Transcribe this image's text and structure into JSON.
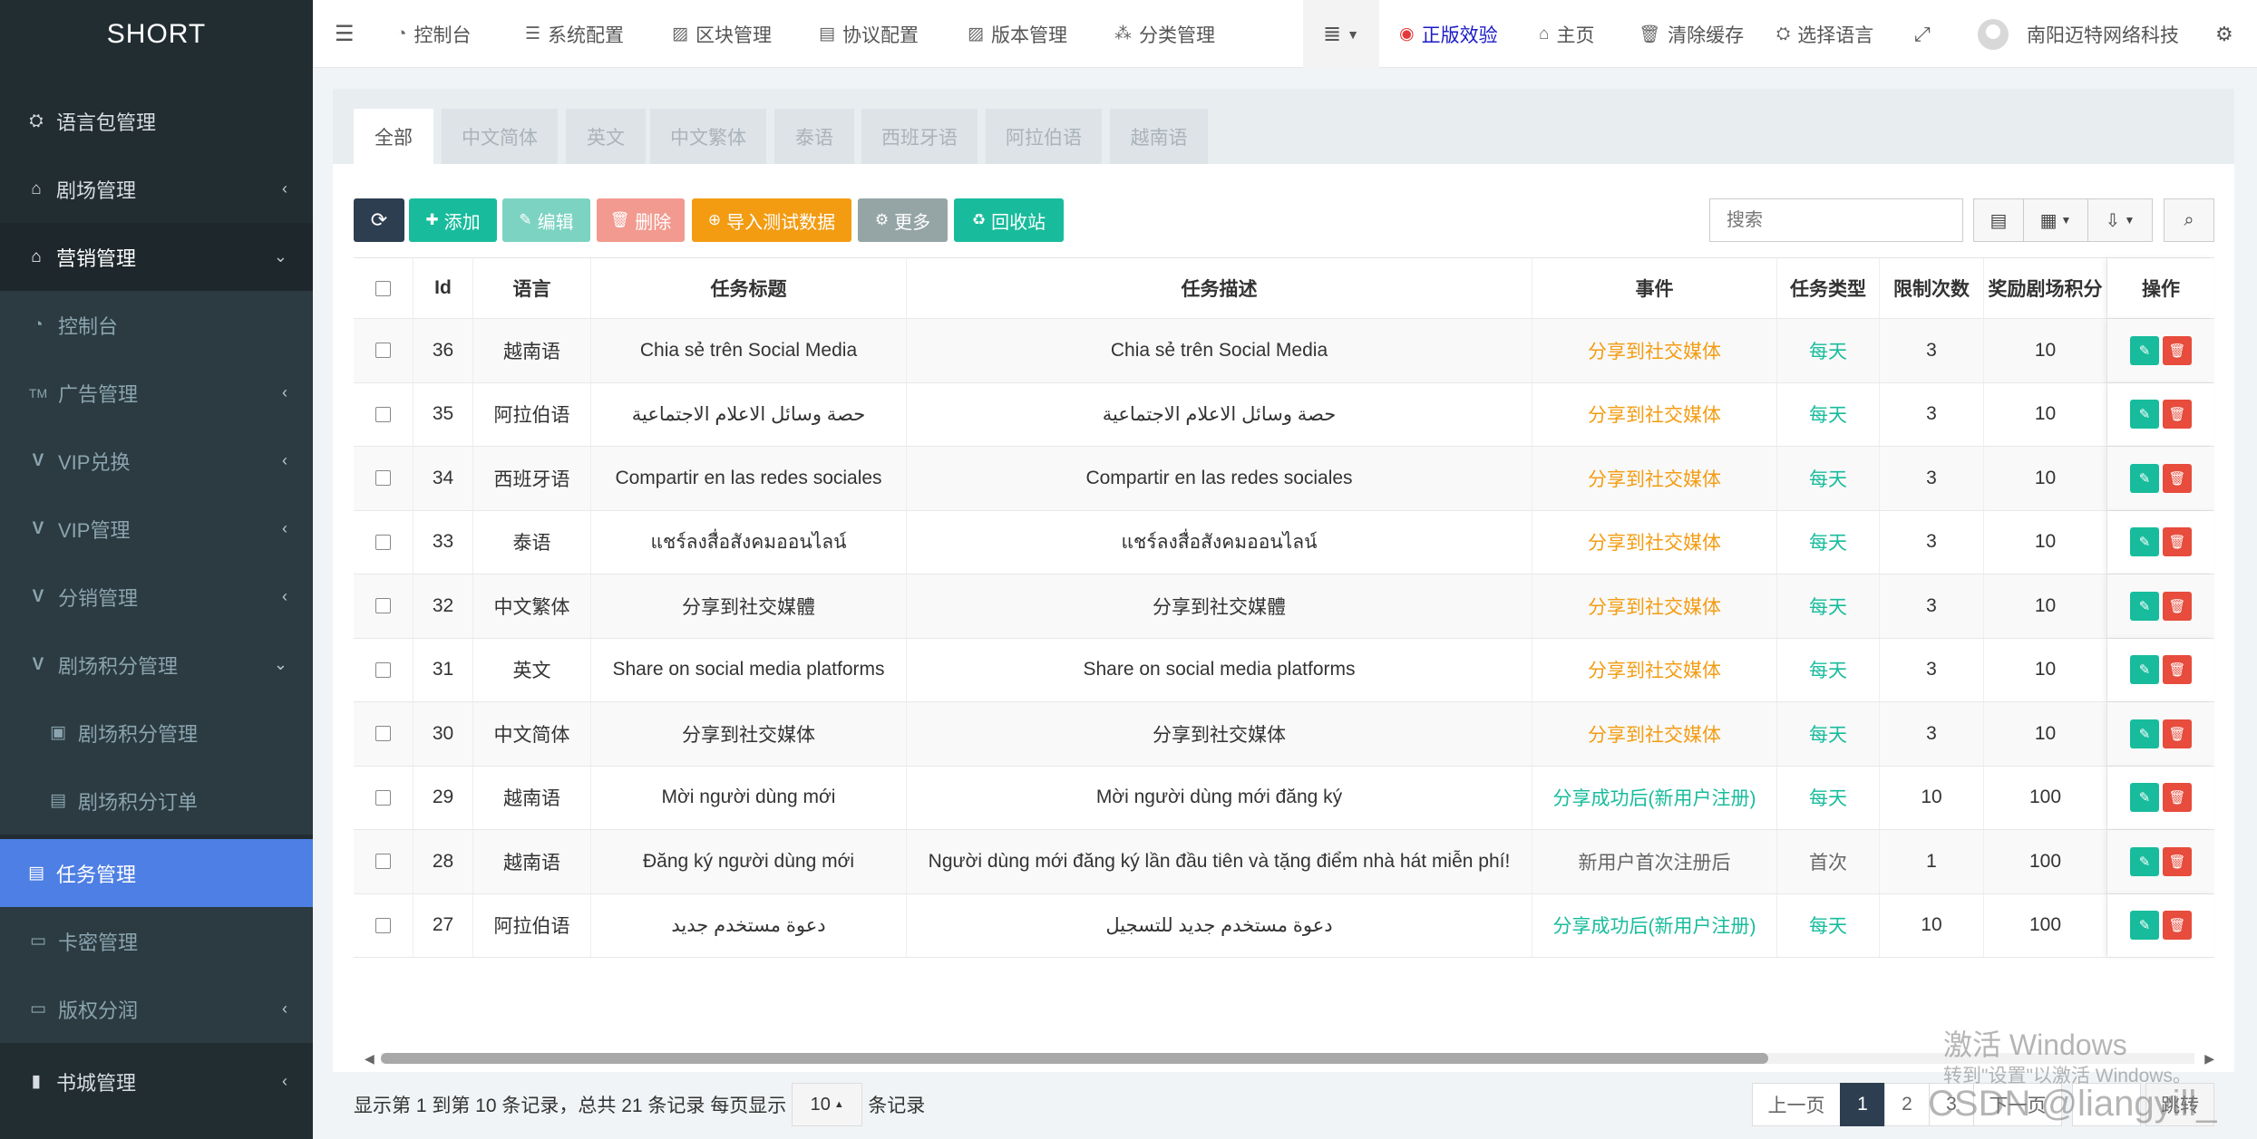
{
  "app": {
    "brand": "SHORT"
  },
  "sidebar": {
    "items": [
      {
        "label": "语言包管理",
        "icon": "language-icon"
      },
      {
        "label": "剧场管理",
        "icon": "home-icon"
      },
      {
        "label": "营销管理",
        "icon": "home-icon"
      },
      {
        "label": "控制台",
        "icon": "dashboard-icon"
      },
      {
        "label": "广告管理",
        "icon": "trademark-icon"
      },
      {
        "label": "VIP兑换",
        "icon": "vip-icon"
      },
      {
        "label": "VIP管理",
        "icon": "vip-icon"
      },
      {
        "label": "分销管理",
        "icon": "vip-icon"
      },
      {
        "label": "剧场积分管理",
        "icon": "vip-icon"
      },
      {
        "label": "剧场积分管理",
        "icon": "vip-badge-icon"
      },
      {
        "label": "剧场积分订单",
        "icon": "file-icon"
      },
      {
        "label": "任务管理",
        "icon": "file-icon"
      },
      {
        "label": "卡密管理",
        "icon": "card-icon"
      },
      {
        "label": "版权分润",
        "icon": "card-icon"
      },
      {
        "label": "书城管理",
        "icon": "book-icon"
      }
    ]
  },
  "topnav": {
    "items": [
      {
        "label": "控制台",
        "icon": "dashboard-icon"
      },
      {
        "label": "系统配置",
        "icon": "sliders-icon"
      },
      {
        "label": "区块管理",
        "icon": "image-icon"
      },
      {
        "label": "协议配置",
        "icon": "file-icon"
      },
      {
        "label": "版本管理",
        "icon": "image-icon"
      },
      {
        "label": "分类管理",
        "icon": "sitemap-icon"
      }
    ],
    "right": {
      "official": "正版效验",
      "home": "主页",
      "clear_cache": "清除缓存",
      "language": "选择语言",
      "user": "南阳迈特网络科技"
    }
  },
  "tabs": [
    "全部",
    "中文简体",
    "英文",
    "中文繁体",
    "泰语",
    "西班牙语",
    "阿拉伯语",
    "越南语"
  ],
  "toolbar": {
    "add": "添加",
    "edit": "编辑",
    "delete": "删除",
    "import": "导入测试数据",
    "more": "更多",
    "recycle": "回收站",
    "search_placeholder": "搜索"
  },
  "table": {
    "headers": {
      "id": "Id",
      "lang": "语言",
      "title": "任务标题",
      "desc": "任务描述",
      "event": "事件",
      "type": "任务类型",
      "limit": "限制次数",
      "reward": "奖励剧场积分",
      "ops": "操作"
    },
    "rows": [
      {
        "id": "36",
        "lang": "越南语",
        "title": "Chia sẻ trên Social Media",
        "desc": "Chia sẻ trên Social Media",
        "event": "分享到社交媒体",
        "event_color": "orange",
        "type": "每天",
        "type_color": "teal",
        "limit": "3",
        "reward": "10"
      },
      {
        "id": "35",
        "lang": "阿拉伯语",
        "title": "حصة وسائل الاعلام الاجتماعية",
        "desc": "حصة وسائل الاعلام الاجتماعية",
        "event": "分享到社交媒体",
        "event_color": "orange",
        "type": "每天",
        "type_color": "teal",
        "limit": "3",
        "reward": "10"
      },
      {
        "id": "34",
        "lang": "西班牙语",
        "title": "Compartir en las redes sociales",
        "desc": "Compartir en las redes sociales",
        "event": "分享到社交媒体",
        "event_color": "orange",
        "type": "每天",
        "type_color": "teal",
        "limit": "3",
        "reward": "10"
      },
      {
        "id": "33",
        "lang": "泰语",
        "title": "แชร์ลงสื่อสังคมออนไลน์",
        "desc": "แชร์ลงสื่อสังคมออนไลน์",
        "event": "分享到社交媒体",
        "event_color": "orange",
        "type": "每天",
        "type_color": "teal",
        "limit": "3",
        "reward": "10"
      },
      {
        "id": "32",
        "lang": "中文繁体",
        "title": "分享到社交媒體",
        "desc": "分享到社交媒體",
        "event": "分享到社交媒体",
        "event_color": "orange",
        "type": "每天",
        "type_color": "teal",
        "limit": "3",
        "reward": "10"
      },
      {
        "id": "31",
        "lang": "英文",
        "title": "Share on social media platforms",
        "desc": "Share on social media platforms",
        "event": "分享到社交媒体",
        "event_color": "orange",
        "type": "每天",
        "type_color": "teal",
        "limit": "3",
        "reward": "10"
      },
      {
        "id": "30",
        "lang": "中文简体",
        "title": "分享到社交媒体",
        "desc": "分享到社交媒体",
        "event": "分享到社交媒体",
        "event_color": "orange",
        "type": "每天",
        "type_color": "teal",
        "limit": "3",
        "reward": "10"
      },
      {
        "id": "29",
        "lang": "越南语",
        "title": "Mời người dùng mới",
        "desc": "Mời người dùng mới đăng ký",
        "event": "分享成功后(新用户注册)",
        "event_color": "teal",
        "type": "每天",
        "type_color": "teal",
        "limit": "10",
        "reward": "100"
      },
      {
        "id": "28",
        "lang": "越南语",
        "title": "Đăng ký người dùng mới",
        "desc": "Người dùng mới đăng ký lần đầu tiên và tặng điểm nhà hát miễn phí!",
        "event": "新用户首次注册后",
        "event_color": "gray",
        "type": "首次",
        "type_color": "gray",
        "limit": "1",
        "reward": "100"
      },
      {
        "id": "27",
        "lang": "阿拉伯语",
        "title": "دعوة مستخدم جديد",
        "desc": "دعوة مستخدم جديد للتسجيل",
        "event": "分享成功后(新用户注册)",
        "event_color": "teal",
        "type": "每天",
        "type_color": "teal",
        "limit": "10",
        "reward": "100"
      }
    ]
  },
  "footer": {
    "info": "显示第 1 到第 10 条记录，总共 21 条记录 每页显示",
    "page_size": "10",
    "suffix": "条记录",
    "prev": "上一页",
    "pages": [
      "1",
      "2",
      "3"
    ],
    "next": "下一页",
    "jump": "跳转"
  },
  "watermark": {
    "activate": "激活 Windows",
    "hint": "转到\"设置\"以激活 Windows。",
    "csdn": "CSDN @liangyill_"
  }
}
